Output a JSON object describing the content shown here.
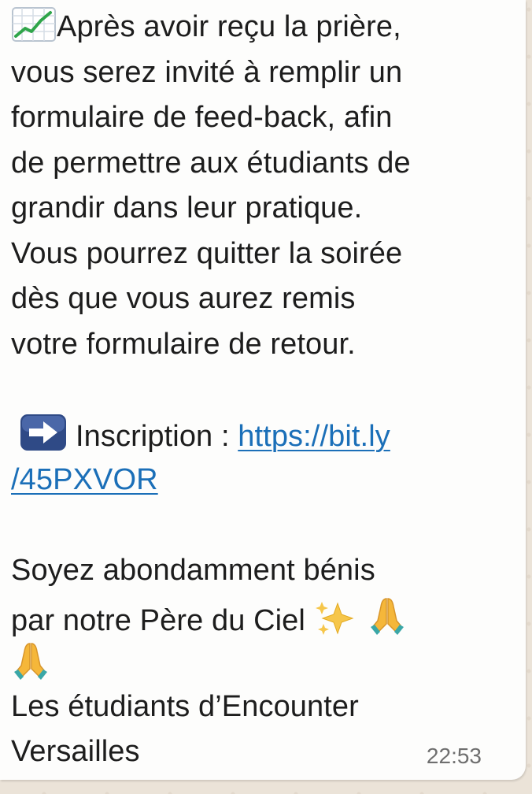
{
  "message": {
    "chart_emoji": "chart-increasing-icon",
    "line1": "Après avoir reçu la prière,",
    "line2": "vous serez invité à remplir un",
    "line3": "formulaire de feed-back, afin",
    "line4": "de permettre aux étudiants de",
    "line5": "grandir dans leur pratique.",
    "line6": "Vous pourrez quitter la soirée",
    "line7": "dès que vous aurez remis",
    "line8": "votre formulaire de retour.",
    "arrow_emoji": "right-arrow-icon",
    "inscription_label": "Inscription : ",
    "link_part1": "https://bit.ly",
    "link_part2": "/45PXVOR",
    "blessing_line1": "Soyez abondamment bénis",
    "blessing_line2": "par notre Père du Ciel ",
    "sparkles_emoji": "sparkles-icon",
    "prayer_emoji": "folded-hands-icon",
    "signature_line1": "Les étudiants d’Encounter",
    "signature_line2": "Versailles",
    "timestamp": "22:53"
  },
  "colors": {
    "bubble": "#fdfdfc",
    "text": "#1d1d1d",
    "link": "#1b6fb8",
    "timestamp": "#6f6f6f",
    "wallpaper": "#ebe3d8"
  }
}
